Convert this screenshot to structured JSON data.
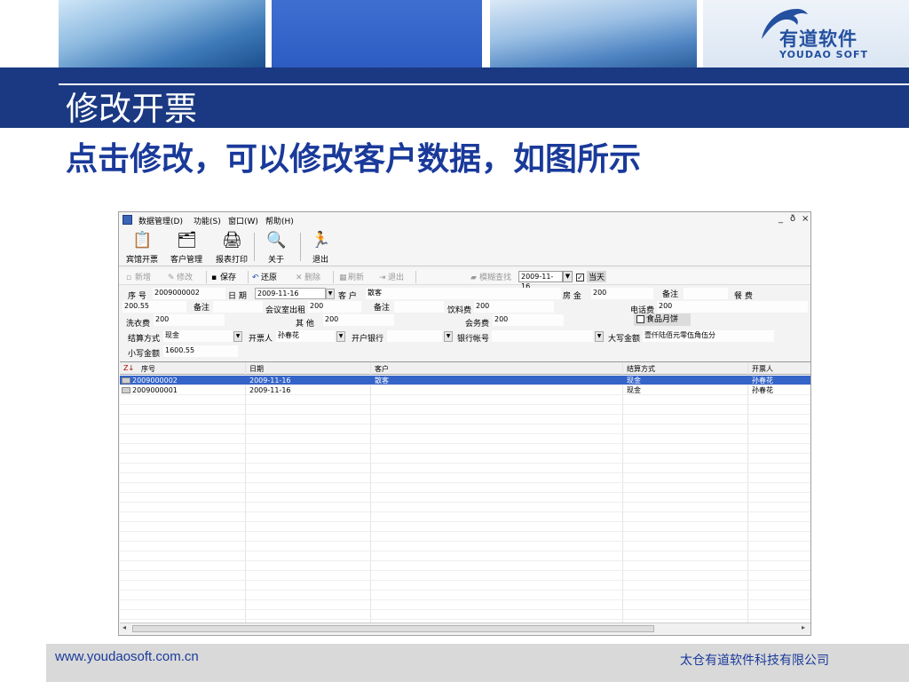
{
  "logo": {
    "cn": "有道软件",
    "en": "YOUDAO SOFT"
  },
  "slide": {
    "title": "修改开票",
    "subtitle": "点击修改，可以修改客户数据，如图所示",
    "footer_url": "www.youdaosoft.com.cn",
    "footer_company": "太仓有道软件科技有限公司"
  },
  "colors": {
    "title_bar": "#1a3982",
    "subtitle_text": "#1a3a9a",
    "selected_row": "#3464c8"
  },
  "app": {
    "menu": [
      "数据管理(D)",
      "功能(S)",
      "窗口(W)",
      "帮助(H)"
    ],
    "window_controls": [
      "_",
      "ð",
      "×"
    ],
    "toolbar": [
      {
        "label": "宾馆开票",
        "icon": "clipboard-icon"
      },
      {
        "label": "客户管理",
        "icon": "documents-icon"
      },
      {
        "label": "报表打印",
        "icon": "printer-icon"
      },
      {
        "label": "关于",
        "icon": "info-icon"
      },
      {
        "label": "退出",
        "icon": "exit-icon"
      }
    ],
    "subtoolbar": {
      "new": "新增",
      "edit": "修改",
      "save": "保存",
      "undo": "还原",
      "delete": "删除",
      "refresh": "刷新",
      "exit": "退出",
      "fuzzy_search": "模糊查找",
      "date": "2009-11-16",
      "today": "当天"
    },
    "form": {
      "seq_label": "序  号",
      "seq_value": "2009000002",
      "date_label": "日  期",
      "date_value": "2009-11-16",
      "customer_label": "客  户",
      "customer_value": "散客",
      "room_label": "房  金",
      "room_value": "200",
      "remark_label": "备注",
      "meal_label": "餐  费",
      "meal_value": "200.55",
      "meal_remark": "备注",
      "meeting_label": "会议室出租",
      "meeting_value": "200",
      "meeting_remark": "备注",
      "drink_label": "饮料费",
      "drink_value": "200",
      "phone_label": "电话费",
      "phone_value": "200",
      "laundry_label": "洗衣费",
      "laundry_value": "200",
      "other_label": "其  他",
      "other_value": "200",
      "service_label": "会务费",
      "service_value": "200",
      "mooncake_label": "食品月饼",
      "pay_label": "结算方式",
      "pay_value": "现金",
      "issuer_label": "开票人",
      "issuer_value": "孙春花",
      "bank_label": "开户银行",
      "bank_value": "",
      "account_label": "银行帐号",
      "account_value": "",
      "upper_label": "大写金额",
      "upper_value": "壹仟陆佰元零伍角伍分",
      "lower_label": "小写金额",
      "lower_value": "1600.55"
    },
    "grid": {
      "columns": [
        "序号",
        "日期",
        "客户",
        "结算方式",
        "开票人"
      ],
      "rows": [
        [
          "2009000002",
          "2009-11-16",
          "散客",
          "现金",
          "孙春花"
        ],
        [
          "2009000001",
          "2009-11-16",
          "",
          "现金",
          "孙春花"
        ]
      ],
      "selected_index": 0,
      "sort_icon": "Z↓"
    }
  }
}
